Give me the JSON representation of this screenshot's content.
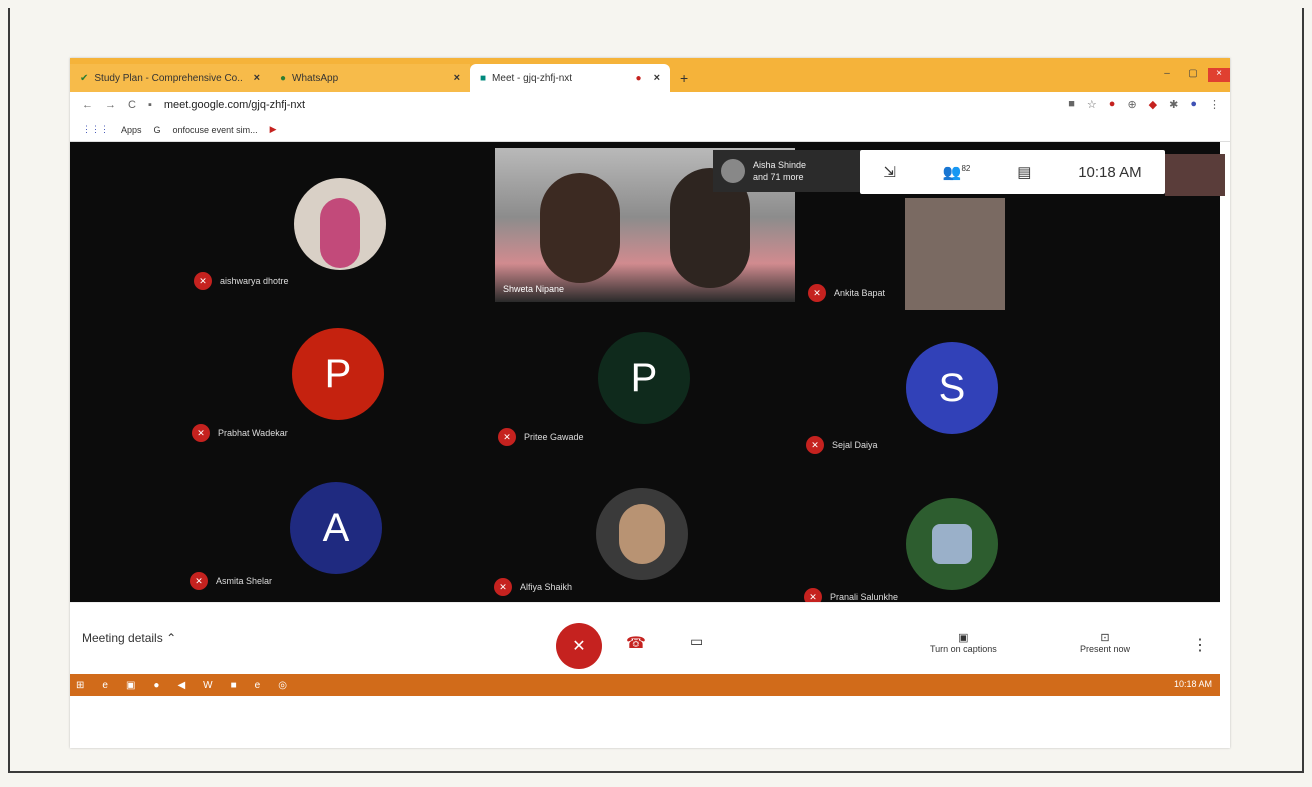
{
  "browser": {
    "tabs": [
      {
        "label": "Study Plan - Comprehensive Co..",
        "state": "inactive"
      },
      {
        "label": "WhatsApp",
        "state": "inactive"
      },
      {
        "label": "Meet - gjq-zhfj-nxt",
        "state": "active"
      }
    ],
    "new_tab": "+",
    "nav": {
      "back": "←",
      "forward": "→",
      "reload": "C"
    },
    "url": "meet.google.com/gjq-zhfj-nxt",
    "bookmarks": [
      "Apps",
      "onfocuse event sim..."
    ]
  },
  "meet": {
    "more_chip": {
      "line1": "Aisha Shinde",
      "line2": "and 71 more"
    },
    "participants_count": "82",
    "time": "10:18 AM",
    "participants": [
      {
        "name": "aishwarya dhotre",
        "type": "photo"
      },
      {
        "name": "Shweta Nipane",
        "type": "video"
      },
      {
        "name": "Ankita Bapat",
        "type": "photo"
      },
      {
        "name": "Prabhat Wadekar",
        "type": "initial",
        "initial": "P",
        "color": "#c5220f"
      },
      {
        "name": "Pritee Gawade",
        "type": "initial",
        "initial": "P",
        "color": "#0f2a1c"
      },
      {
        "name": "Sejal Daiya",
        "type": "initial",
        "initial": "S",
        "color": "#3141b8"
      },
      {
        "name": "Asmita Shelar",
        "type": "initial",
        "initial": "A",
        "color": "#1f2a80"
      },
      {
        "name": "Alfiya Shaikh",
        "type": "photo"
      },
      {
        "name": "Pranali Salunkhe",
        "type": "photo"
      }
    ]
  },
  "controls": {
    "meeting_details": "Meeting details",
    "captions": "Turn on captions",
    "present": "Present now"
  },
  "taskbar": {
    "clock": "10:18 AM"
  },
  "colors": {
    "tab_bar": "#f5b33a",
    "taskbar": "#d16b1a",
    "mic_red": "#c5221f"
  }
}
